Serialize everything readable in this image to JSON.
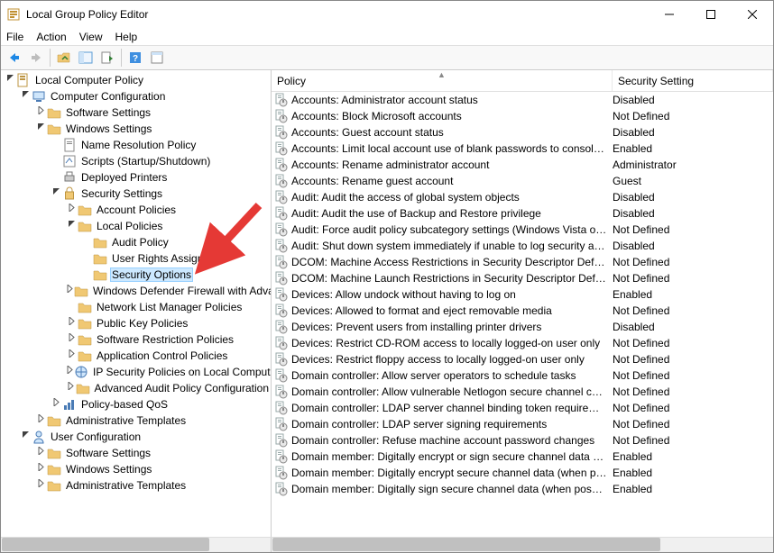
{
  "window_title": "Local Group Policy Editor",
  "menu": [
    "File",
    "Action",
    "View",
    "Help"
  ],
  "columns": {
    "policy": "Policy",
    "setting": "Security Setting"
  },
  "tree": [
    {
      "d": 0,
      "exp": "open",
      "icon": "gpedit",
      "label": "Local Computer Policy"
    },
    {
      "d": 1,
      "exp": "open",
      "icon": "computer",
      "label": "Computer Configuration"
    },
    {
      "d": 2,
      "exp": "col",
      "icon": "folder",
      "label": "Software Settings"
    },
    {
      "d": 2,
      "exp": "open",
      "icon": "folder",
      "label": "Windows Settings"
    },
    {
      "d": 3,
      "exp": "none",
      "icon": "doc",
      "label": "Name Resolution Policy"
    },
    {
      "d": 3,
      "exp": "none",
      "icon": "script",
      "label": "Scripts (Startup/Shutdown)"
    },
    {
      "d": 3,
      "exp": "none",
      "icon": "printer",
      "label": "Deployed Printers"
    },
    {
      "d": 3,
      "exp": "open",
      "icon": "security",
      "label": "Security Settings"
    },
    {
      "d": 4,
      "exp": "col",
      "icon": "folder",
      "label": "Account Policies"
    },
    {
      "d": 4,
      "exp": "open",
      "icon": "folder",
      "label": "Local Policies"
    },
    {
      "d": 5,
      "exp": "none",
      "icon": "folder",
      "label": "Audit Policy"
    },
    {
      "d": 5,
      "exp": "none",
      "icon": "folder",
      "label": "User Rights Assignment"
    },
    {
      "d": 5,
      "exp": "none",
      "icon": "folder",
      "label": "Security Options",
      "selected": true
    },
    {
      "d": 4,
      "exp": "col",
      "icon": "folder",
      "label": "Windows Defender Firewall with Advanced Security"
    },
    {
      "d": 4,
      "exp": "none",
      "icon": "folder",
      "label": "Network List Manager Policies"
    },
    {
      "d": 4,
      "exp": "col",
      "icon": "folder",
      "label": "Public Key Policies"
    },
    {
      "d": 4,
      "exp": "col",
      "icon": "folder",
      "label": "Software Restriction Policies"
    },
    {
      "d": 4,
      "exp": "col",
      "icon": "folder",
      "label": "Application Control Policies"
    },
    {
      "d": 4,
      "exp": "col",
      "icon": "ipsec",
      "label": "IP Security Policies on Local Computer"
    },
    {
      "d": 4,
      "exp": "col",
      "icon": "folder",
      "label": "Advanced Audit Policy Configuration"
    },
    {
      "d": 3,
      "exp": "col",
      "icon": "qos",
      "label": "Policy-based QoS"
    },
    {
      "d": 2,
      "exp": "col",
      "icon": "folder",
      "label": "Administrative Templates"
    },
    {
      "d": 1,
      "exp": "open",
      "icon": "user",
      "label": "User Configuration"
    },
    {
      "d": 2,
      "exp": "col",
      "icon": "folder",
      "label": "Software Settings"
    },
    {
      "d": 2,
      "exp": "col",
      "icon": "folder",
      "label": "Windows Settings"
    },
    {
      "d": 2,
      "exp": "col",
      "icon": "folder",
      "label": "Administrative Templates"
    }
  ],
  "policies": [
    {
      "p": "Accounts: Administrator account status",
      "s": "Disabled"
    },
    {
      "p": "Accounts: Block Microsoft accounts",
      "s": "Not Defined"
    },
    {
      "p": "Accounts: Guest account status",
      "s": "Disabled"
    },
    {
      "p": "Accounts: Limit local account use of blank passwords to console logon only",
      "s": "Enabled"
    },
    {
      "p": "Accounts: Rename administrator account",
      "s": "Administrator"
    },
    {
      "p": "Accounts: Rename guest account",
      "s": "Guest"
    },
    {
      "p": "Audit: Audit the access of global system objects",
      "s": "Disabled"
    },
    {
      "p": "Audit: Audit the use of Backup and Restore privilege",
      "s": "Disabled"
    },
    {
      "p": "Audit: Force audit policy subcategory settings (Windows Vista or later)",
      "s": "Not Defined"
    },
    {
      "p": "Audit: Shut down system immediately if unable to log security audit",
      "s": "Disabled"
    },
    {
      "p": "DCOM: Machine Access Restrictions in Security Descriptor Definition Language",
      "s": "Not Defined"
    },
    {
      "p": "DCOM: Machine Launch Restrictions in Security Descriptor Definition Language",
      "s": "Not Defined"
    },
    {
      "p": "Devices: Allow undock without having to log on",
      "s": "Enabled"
    },
    {
      "p": "Devices: Allowed to format and eject removable media",
      "s": "Not Defined"
    },
    {
      "p": "Devices: Prevent users from installing printer drivers",
      "s": "Disabled"
    },
    {
      "p": "Devices: Restrict CD-ROM access to locally logged-on user only",
      "s": "Not Defined"
    },
    {
      "p": "Devices: Restrict floppy access to locally logged-on user only",
      "s": "Not Defined"
    },
    {
      "p": "Domain controller: Allow server operators to schedule tasks",
      "s": "Not Defined"
    },
    {
      "p": "Domain controller: Allow vulnerable Netlogon secure channel connections",
      "s": "Not Defined"
    },
    {
      "p": "Domain controller: LDAP server channel binding token requirements",
      "s": "Not Defined"
    },
    {
      "p": "Domain controller: LDAP server signing requirements",
      "s": "Not Defined"
    },
    {
      "p": "Domain controller: Refuse machine account password changes",
      "s": "Not Defined"
    },
    {
      "p": "Domain member: Digitally encrypt or sign secure channel data (always)",
      "s": "Enabled"
    },
    {
      "p": "Domain member: Digitally encrypt secure channel data (when possible)",
      "s": "Enabled"
    },
    {
      "p": "Domain member: Digitally sign secure channel data (when possible)",
      "s": "Enabled"
    }
  ]
}
